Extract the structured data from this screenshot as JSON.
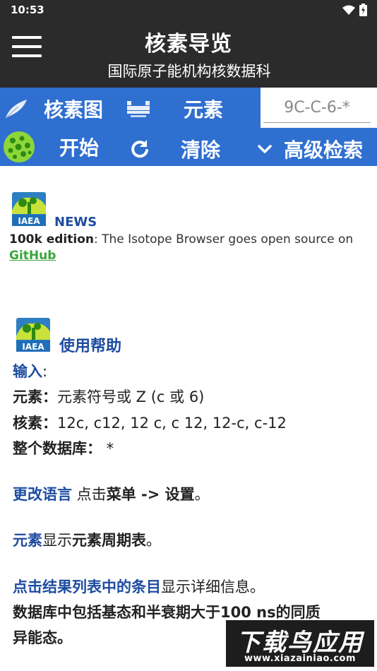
{
  "status_bar": {
    "time": "10:53"
  },
  "app_bar": {
    "title": "核素导览",
    "subtitle": "国际原子能机构核数据科"
  },
  "toolbar": {
    "nuclide_chart_label": "核素图",
    "elements_label": "元素",
    "search_placeholder": "9C-C-6-*",
    "start_label": "开始",
    "clear_label": "清除",
    "advanced_search_label": "高级检索"
  },
  "news": {
    "logo_text": "IAEA",
    "title": "NEWS",
    "edition_bold": "100k edition",
    "edition_text": ": The Isotope Browser goes open source on",
    "link": "GitHub"
  },
  "help": {
    "logo_text": "IAEA",
    "title": "使用帮助",
    "input_label": "输入",
    "input_colon": ":",
    "element_label": "元素：",
    "element_text": "元素符号或 Z (c 或 6)",
    "nuclide_label": "核素：",
    "nuclide_text": "12c, c12, 12 c, c 12, 12-c, c-12",
    "database_label": "整个数据库：",
    "database_text": " *",
    "change_lang_link": "更改语言",
    "change_lang_text1": " 点击",
    "change_lang_bold1": "菜单",
    "change_lang_bold2": " -> 设置",
    "change_lang_text2": "。",
    "elements_link": "元素",
    "elements_text": "显示",
    "elements_bold": "元素周期表",
    "elements_end": "。",
    "results_link": "点击结果列表中的条目",
    "results_text": "显示详细信息。",
    "db_line1": "数据库中包括基态和半衰期大于100 ns的同质",
    "db_line2": "异能态。"
  },
  "watermark": {
    "big": "下载鸟应用",
    "small": "www.xiazainiao.com"
  },
  "colors": {
    "dark_bar": "#2b2b2b",
    "toolbar_blue": "#2f6fd0",
    "link_blue": "#1e4ca0",
    "link_green": "#3aa53a"
  }
}
